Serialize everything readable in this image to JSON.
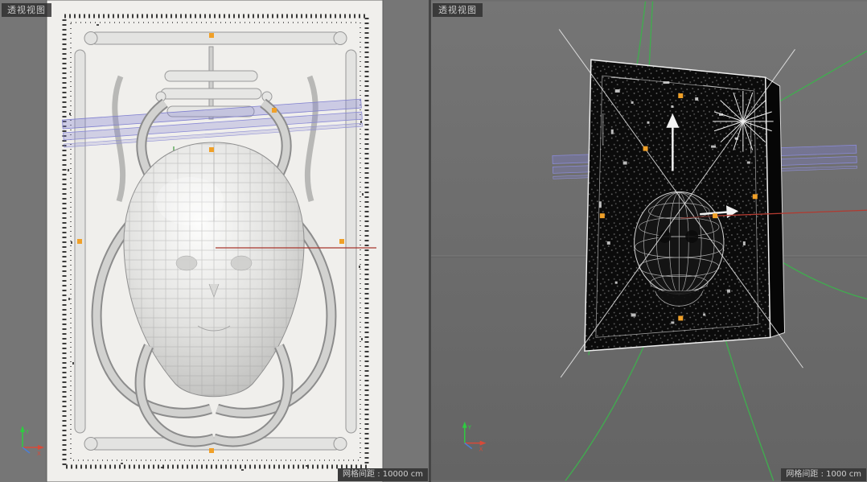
{
  "viewports": {
    "left": {
      "label": "透视视图",
      "grid_spacing_label": "网格间距 : 10000 cm",
      "axis_labels": {
        "x": "X",
        "y": "Y"
      }
    },
    "right": {
      "label": "透视视图",
      "grid_spacing_label": "网格间距 : 1000 cm",
      "axis_labels": {
        "x": "X",
        "y": "Y"
      }
    }
  },
  "colors": {
    "selection_handle_orange": "#f0a028",
    "axis_x_red": "#d84a38",
    "axis_y_green": "#2ecc40",
    "axis_z_blue": "#4a7fd8",
    "spline_green": "#3fae4e",
    "beam_purple": "#8a8ad6",
    "world_x_line_red": "#a8362c",
    "viewport_bg_left": "#767676",
    "viewport_bg_right": "#6e6e6e",
    "label_bg": "#3a3a3a"
  },
  "icons": {
    "selection_handle": "orange square",
    "axis_gizmo": "xyz arrows",
    "translate_arrow": "white arrow"
  }
}
